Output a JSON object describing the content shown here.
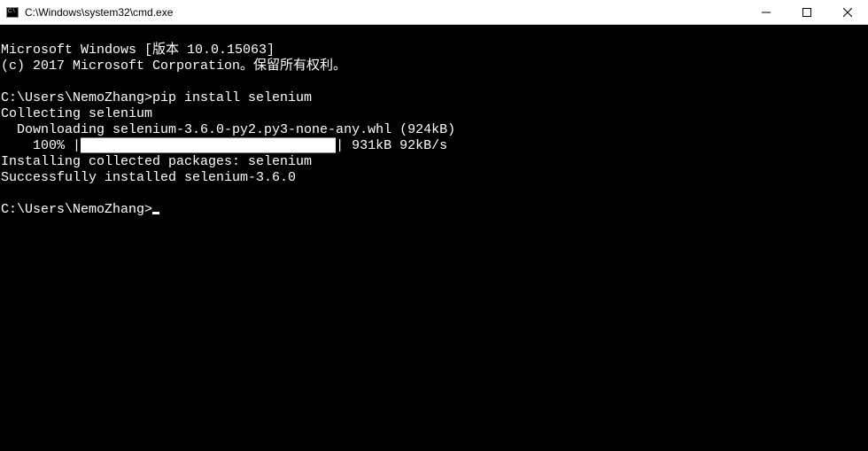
{
  "titlebar": {
    "title": "C:\\Windows\\system32\\cmd.exe",
    "minimize": "—",
    "maximize": "▢",
    "close": "✕"
  },
  "terminal": {
    "line1": "Microsoft Windows [版本 10.0.15063]",
    "line2": "(c) 2017 Microsoft Corporation。保留所有权利。",
    "line3_prompt": "C:\\Users\\NemoZhang>",
    "line3_cmd": "pip install selenium",
    "line4": "Collecting selenium",
    "line5": "  Downloading selenium-3.6.0-py2.py3-none-any.whl (924kB)",
    "line6_pct": "    100% |",
    "line6_bar": "████████████████████████████████",
    "line6_stats": "| 931kB 92kB/s",
    "line7": "Installing collected packages: selenium",
    "line8": "Successfully installed selenium-3.6.0",
    "line9_prompt": "C:\\Users\\NemoZhang>"
  }
}
